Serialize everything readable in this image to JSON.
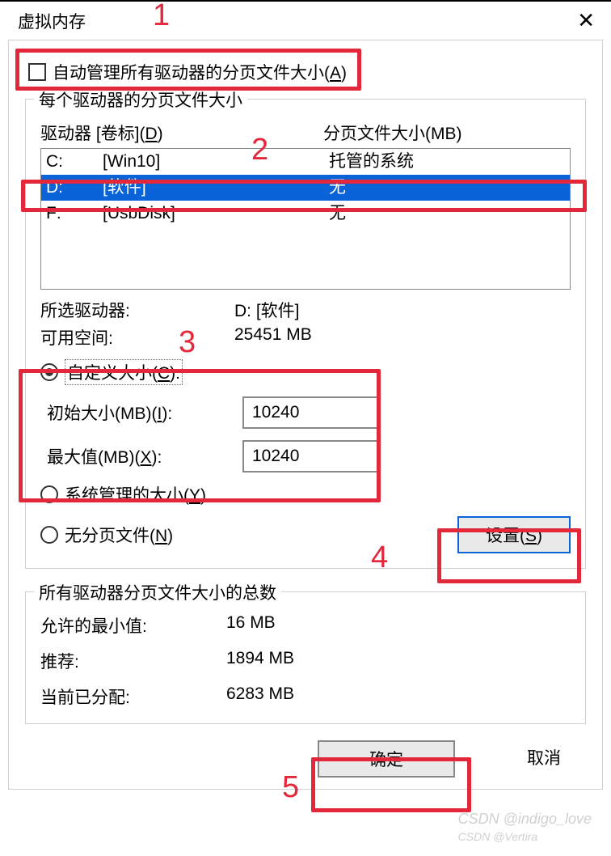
{
  "title": "虚拟内存",
  "auto_manage_label_pre": "自动管理所有驱动器的分页文件大小(",
  "auto_manage_hotkey": "A",
  "auto_manage_label_post": ")",
  "group_per_drive": "每个驱动器的分页文件大小",
  "drive_header_left_pre": "驱动器 [卷标](",
  "drive_header_left_hk": "D",
  "drive_header_left_post": ")",
  "drive_header_right": "分页文件大小(MB)",
  "drives": [
    {
      "letter": "C:",
      "volume": "[Win10]",
      "paging": "托管的系统"
    },
    {
      "letter": "D:",
      "volume": "[软件]",
      "paging": "无"
    },
    {
      "letter": "F:",
      "volume": "[UsbDisk]",
      "paging": "无"
    }
  ],
  "selected_drive_label": "所选驱动器:",
  "selected_drive_value": "D:  [软件]",
  "free_space_label": "可用空间:",
  "free_space_value": "25451 MB",
  "radio_custom_pre": "自定义大小(",
  "radio_custom_hk": "C",
  "radio_custom_post": "):",
  "initial_label_pre": "初始大小(MB)(",
  "initial_hk": "I",
  "initial_label_post": "):",
  "initial_value": "10240",
  "max_label_pre": "最大值(MB)(",
  "max_hk": "X",
  "max_label_post": "):",
  "max_value": "10240",
  "radio_system_pre": "系统管理的大小(",
  "radio_system_hk": "Y",
  "radio_system_post": ")",
  "radio_none_pre": "无分页文件(",
  "radio_none_hk": "N",
  "radio_none_post": ")",
  "set_btn_pre": "设置(",
  "set_btn_hk": "S",
  "set_btn_post": ")",
  "group_totals": "所有驱动器分页文件大小的总数",
  "min_allowed_label": "允许的最小值:",
  "min_allowed_value": "16 MB",
  "recommended_label": "推荐:",
  "recommended_value": "1894 MB",
  "current_label": "当前已分配:",
  "current_value": "6283 MB",
  "ok_btn": "确定",
  "cancel_btn": "取消",
  "annotations": {
    "a1": "1",
    "a2": "2",
    "a3": "3",
    "a4": "4",
    "a5": "5"
  },
  "watermark": "CSDN @indigo_love",
  "watermark2": "CSDN @Vertira"
}
